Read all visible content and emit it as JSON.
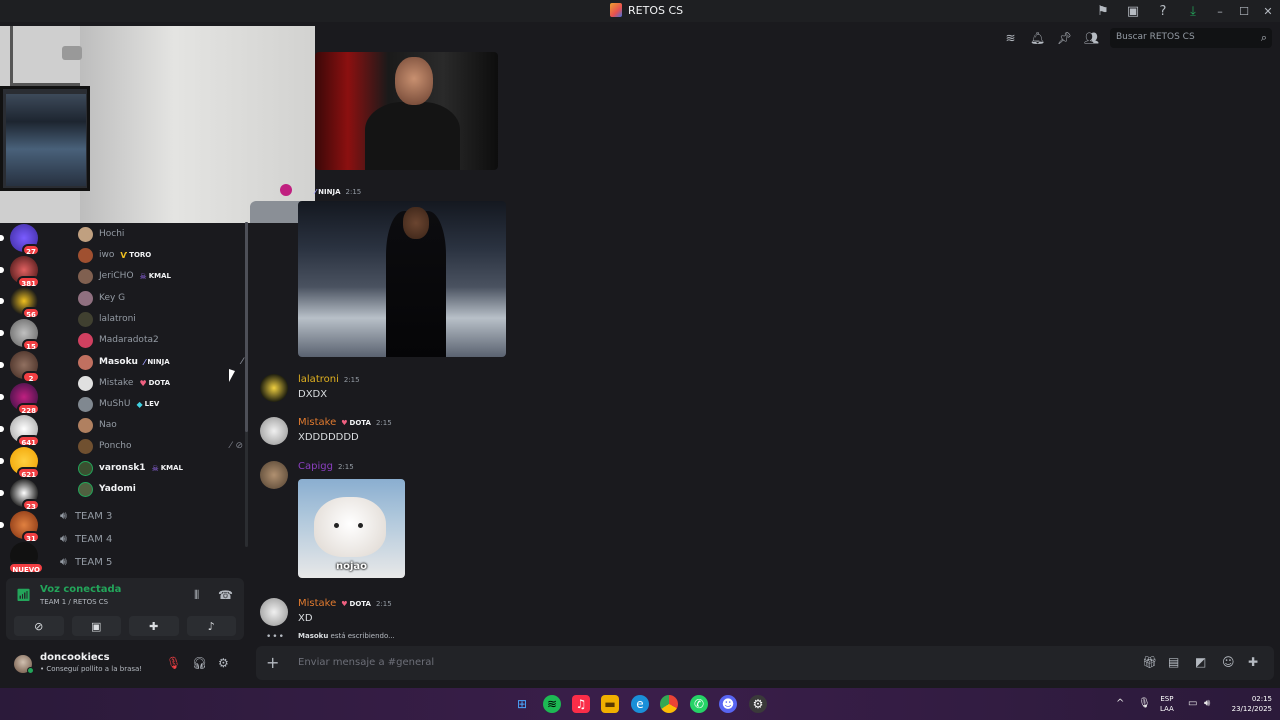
{
  "titlebar": {
    "title": "RETOS CS"
  },
  "search": {
    "placeholder": "Buscar RETOS CS"
  },
  "guilds": [
    {
      "badge": "27"
    },
    {
      "badge": "381"
    },
    {
      "badge": "56"
    },
    {
      "badge": "15"
    },
    {
      "badge": "2"
    },
    {
      "badge": "228"
    },
    {
      "badge": "641"
    },
    {
      "badge": "621"
    },
    {
      "badge": "23"
    },
    {
      "badge": "31"
    },
    {
      "badge": "NUEVO"
    }
  ],
  "members": [
    {
      "name": "Hochi",
      "tag": ""
    },
    {
      "name": "iwo",
      "tag": "TORO"
    },
    {
      "name": "JeriCHO",
      "tag": "KMAL"
    },
    {
      "name": "Key G",
      "tag": ""
    },
    {
      "name": "lalatroni",
      "tag": ""
    },
    {
      "name": "Madaradota2",
      "tag": ""
    },
    {
      "name": "Masoku",
      "tag": "NINJA"
    },
    {
      "name": "Mistake",
      "tag": "DOTA"
    },
    {
      "name": "MuShU",
      "tag": "LEV"
    },
    {
      "name": "Nao",
      "tag": ""
    },
    {
      "name": "Poncho",
      "tag": ""
    },
    {
      "name": "varonsk1",
      "tag": "KMAL"
    },
    {
      "name": "Yadomi",
      "tag": ""
    }
  ],
  "channels": [
    "TEAM 3",
    "TEAM 4",
    "TEAM 5"
  ],
  "voice": {
    "status": "Voz conectada",
    "subtitle": "TEAM 1 / RETOS CS"
  },
  "user": {
    "name": "doncookiecs",
    "status": "• Conseguí pollito a la brasa!"
  },
  "messages": {
    "ninja_tag": "NINJA",
    "ninja_time": "2:15",
    "m1": {
      "author": "lalatroni",
      "time": "2:15",
      "text": "DXDX"
    },
    "m2": {
      "author": "Mistake",
      "tag": "DOTA",
      "time": "2:15",
      "text": "XDDDDDDD"
    },
    "m3": {
      "author": "Capigg",
      "time": "2:15",
      "image_caption": "nojao"
    },
    "m4": {
      "author": "Mistake",
      "tag": "DOTA",
      "time": "2:15",
      "text": "XD"
    }
  },
  "typing": {
    "user": "Masoku",
    "text": " está escribiendo..."
  },
  "composer": {
    "placeholder": "Enviar mensaje a #general"
  },
  "taskbar": {
    "lang1": "ESP",
    "lang2": "LAA",
    "time": "02:15",
    "date": "23/12/2025"
  },
  "colors": {
    "accent_green": "#23a55a",
    "mistake_color": "#e07a2f",
    "lalatroni_color": "#e0b020",
    "capigg_color": "#8a3fbf"
  }
}
